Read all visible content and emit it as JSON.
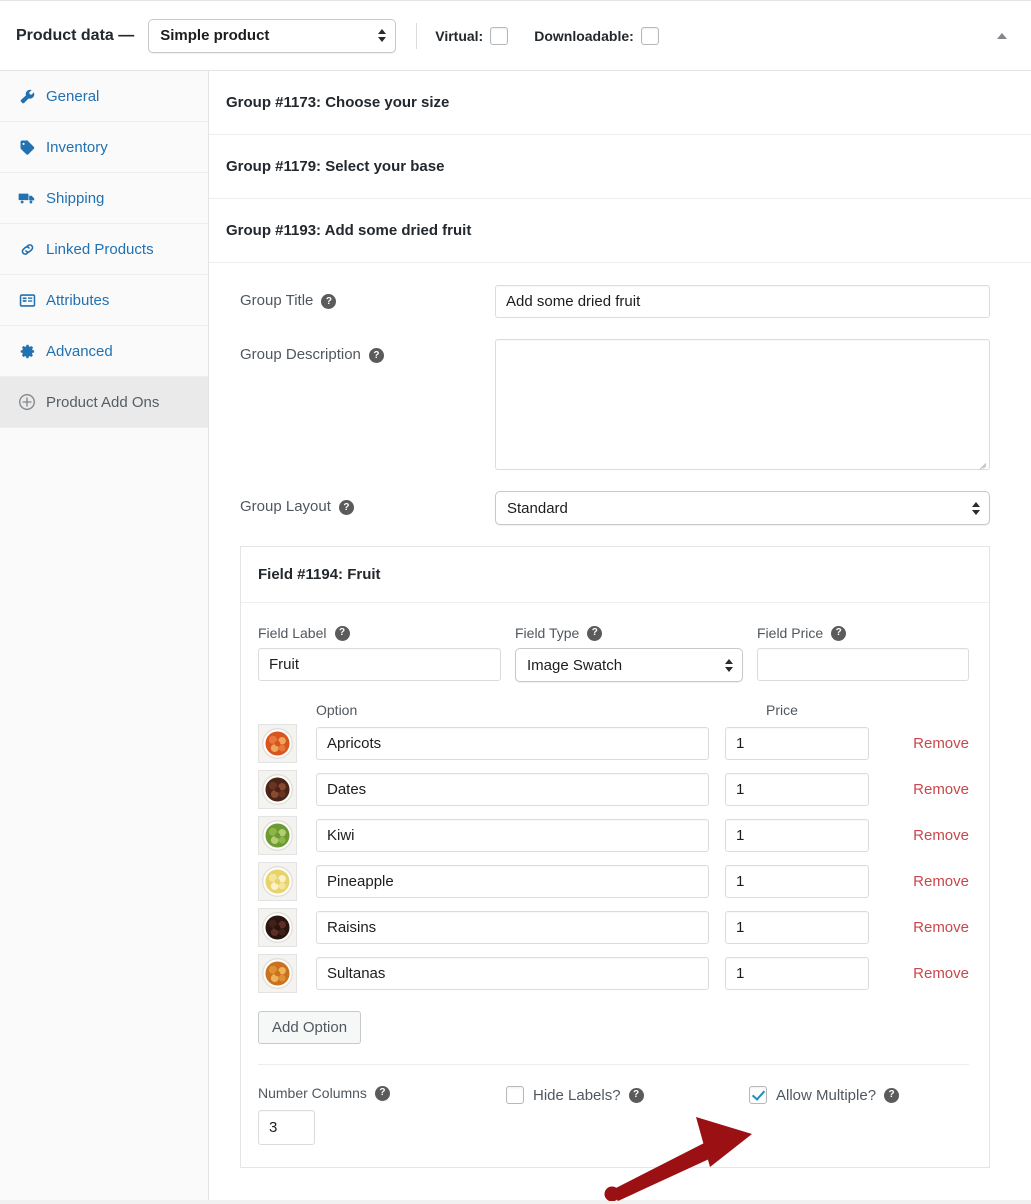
{
  "topbar": {
    "title": "Product data —",
    "product_type": "Simple product",
    "virtual_label": "Virtual:",
    "virtual_checked": false,
    "downloadable_label": "Downloadable:",
    "downloadable_checked": false
  },
  "sidebar": {
    "items": [
      {
        "label": "General",
        "icon": "wrench-icon",
        "active": false
      },
      {
        "label": "Inventory",
        "icon": "tag-icon",
        "active": false
      },
      {
        "label": "Shipping",
        "icon": "truck-icon",
        "active": false
      },
      {
        "label": "Linked Products",
        "icon": "link-icon",
        "active": false
      },
      {
        "label": "Attributes",
        "icon": "list-icon",
        "active": false
      },
      {
        "label": "Advanced",
        "icon": "gear-icon",
        "active": false
      },
      {
        "label": "Product Add Ons",
        "icon": "plus-circle-icon",
        "active": true
      }
    ]
  },
  "groups": [
    {
      "header": "Group #1173: Choose your size"
    },
    {
      "header": "Group #1179: Select your base"
    },
    {
      "header": "Group #1193: Add some dried fruit"
    }
  ],
  "group_form": {
    "title_label": "Group Title",
    "title_value": "Add some dried fruit",
    "description_label": "Group Description",
    "description_value": "",
    "layout_label": "Group Layout",
    "layout_value": "Standard"
  },
  "field": {
    "header": "Field #1194: Fruit",
    "label_label": "Field Label",
    "label_value": "Fruit",
    "type_label": "Field Type",
    "type_value": "Image Swatch",
    "price_label": "Field Price",
    "price_value": "",
    "option_column": "Option",
    "price_column": "Price",
    "remove_label": "Remove",
    "add_option_label": "Add Option",
    "options": [
      {
        "name": "Apricots",
        "price": "1",
        "swatch": "apricots-swatch",
        "colors": [
          "#d8551f",
          "#e8773a",
          "#f0a55e"
        ]
      },
      {
        "name": "Dates",
        "price": "1",
        "swatch": "dates-swatch",
        "colors": [
          "#4b2418",
          "#6b3422",
          "#8a4a2e"
        ]
      },
      {
        "name": "Kiwi",
        "price": "1",
        "swatch": "kiwi-swatch",
        "colors": [
          "#6d9a32",
          "#8cb648",
          "#b3cf72"
        ]
      },
      {
        "name": "Pineapple",
        "price": "1",
        "swatch": "pineapple-swatch",
        "colors": [
          "#e8d26a",
          "#f3e59c",
          "#faf2c8"
        ]
      },
      {
        "name": "Raisins",
        "price": "1",
        "swatch": "raisins-swatch",
        "colors": [
          "#2a1410",
          "#42201a",
          "#5c2f24"
        ]
      },
      {
        "name": "Sultanas",
        "price": "1",
        "swatch": "sultanas-swatch",
        "colors": [
          "#c9711f",
          "#de9133",
          "#eeb45c"
        ]
      }
    ],
    "number_columns_label": "Number Columns",
    "number_columns_value": "3",
    "hide_labels_label": "Hide Labels?",
    "hide_labels_checked": false,
    "allow_multiple_label": "Allow Multiple?",
    "allow_multiple_checked": true
  },
  "colors": {
    "link_blue": "#2271b1",
    "remove_red": "#c9474d",
    "check_blue": "#1e8cbe",
    "annotation_arrow": "#9b1012",
    "active_bg": "#eaeaea"
  },
  "annotation": {
    "arrow": "points to Allow Multiple? checkbox"
  }
}
